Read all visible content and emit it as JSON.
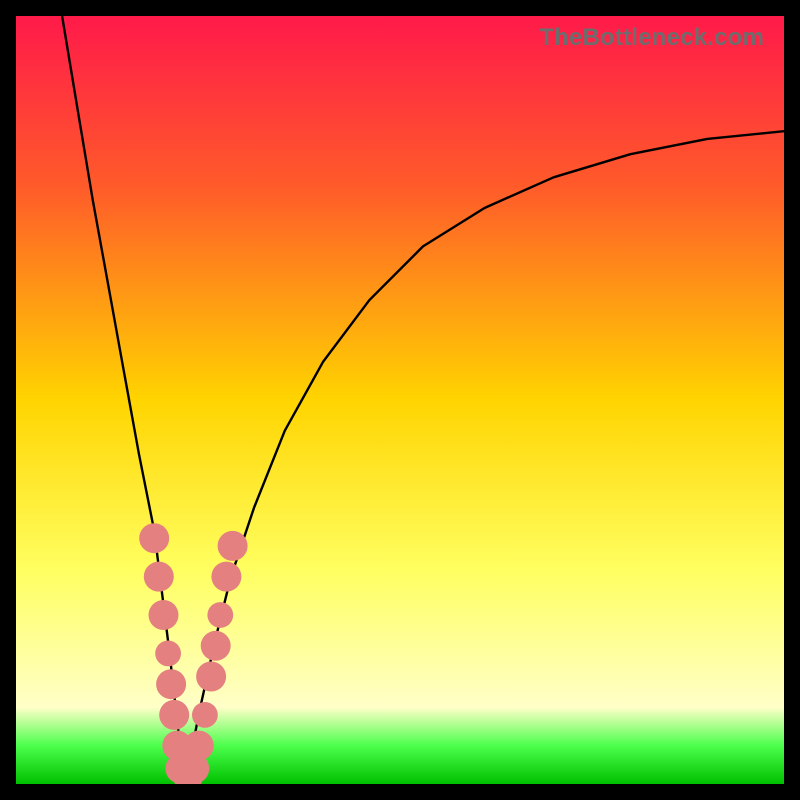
{
  "watermark": "TheBottleneck.com",
  "colors": {
    "top": "#ff1a4a",
    "midtop": "#ff5a2a",
    "mid": "#ffd400",
    "midbot": "#ffff60",
    "bot_pale": "#ffffc8",
    "green_band": "#4cff4c",
    "green_bottom": "#00c000",
    "curve": "#000000",
    "marker_fill": "#e48080",
    "marker_stroke": "#c86060"
  },
  "chart_data": {
    "type": "line",
    "title": "",
    "xlabel": "",
    "ylabel": "",
    "xlim": [
      0,
      100
    ],
    "ylim": [
      0,
      100
    ],
    "curve": {
      "min_x": 22,
      "left": [
        {
          "x": 6,
          "y": 100
        },
        {
          "x": 8,
          "y": 88
        },
        {
          "x": 10,
          "y": 76
        },
        {
          "x": 12,
          "y": 65
        },
        {
          "x": 14,
          "y": 54
        },
        {
          "x": 16,
          "y": 43
        },
        {
          "x": 18,
          "y": 33
        },
        {
          "x": 19,
          "y": 25
        },
        {
          "x": 20,
          "y": 17
        },
        {
          "x": 21,
          "y": 8
        },
        {
          "x": 22,
          "y": 0
        }
      ],
      "right": [
        {
          "x": 22,
          "y": 0
        },
        {
          "x": 24,
          "y": 10
        },
        {
          "x": 26,
          "y": 19
        },
        {
          "x": 28,
          "y": 27
        },
        {
          "x": 31,
          "y": 36
        },
        {
          "x": 35,
          "y": 46
        },
        {
          "x": 40,
          "y": 55
        },
        {
          "x": 46,
          "y": 63
        },
        {
          "x": 53,
          "y": 70
        },
        {
          "x": 61,
          "y": 75
        },
        {
          "x": 70,
          "y": 79
        },
        {
          "x": 80,
          "y": 82
        },
        {
          "x": 90,
          "y": 84
        },
        {
          "x": 100,
          "y": 85
        }
      ]
    },
    "markers": [
      {
        "x": 18.0,
        "y": 32,
        "r": 1.3
      },
      {
        "x": 18.6,
        "y": 27,
        "r": 1.3
      },
      {
        "x": 19.2,
        "y": 22,
        "r": 1.3
      },
      {
        "x": 19.8,
        "y": 17,
        "r": 1.0
      },
      {
        "x": 20.2,
        "y": 13,
        "r": 1.3
      },
      {
        "x": 20.6,
        "y": 9,
        "r": 1.3
      },
      {
        "x": 21.0,
        "y": 5,
        "r": 1.3
      },
      {
        "x": 21.4,
        "y": 2,
        "r": 1.3
      },
      {
        "x": 22.4,
        "y": 1,
        "r": 1.3
      },
      {
        "x": 23.2,
        "y": 2,
        "r": 1.3
      },
      {
        "x": 23.8,
        "y": 5,
        "r": 1.3
      },
      {
        "x": 24.6,
        "y": 9,
        "r": 1.0
      },
      {
        "x": 25.4,
        "y": 14,
        "r": 1.3
      },
      {
        "x": 26.0,
        "y": 18,
        "r": 1.3
      },
      {
        "x": 26.6,
        "y": 22,
        "r": 1.0
      },
      {
        "x": 27.4,
        "y": 27,
        "r": 1.3
      },
      {
        "x": 28.2,
        "y": 31,
        "r": 1.3
      }
    ]
  }
}
